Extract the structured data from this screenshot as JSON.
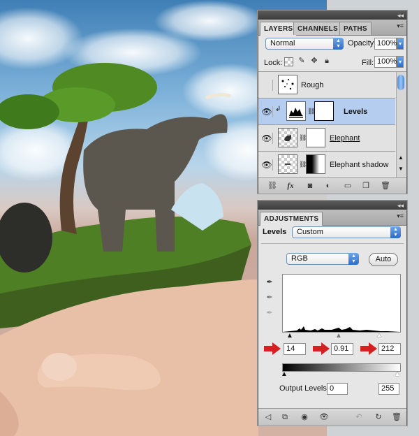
{
  "layers_panel": {
    "tabs": [
      "LAYERS",
      "CHANNELS",
      "PATHS"
    ],
    "blend_mode": "Normal",
    "opacity_label": "Opacity:",
    "opacity_value": "100%",
    "lock_label": "Lock:",
    "fill_label": "Fill:",
    "fill_value": "100%",
    "layers": [
      {
        "name": "Rough",
        "visible": false
      },
      {
        "name": "Levels",
        "visible": true,
        "selected": true
      },
      {
        "name": "Elephant",
        "visible": true
      },
      {
        "name": "Elephant shadow",
        "visible": true
      }
    ],
    "bottom_icons": [
      "link-icon",
      "fx-icon",
      "mask-icon",
      "adjustment-icon",
      "group-icon",
      "new-layer-icon",
      "trash-icon"
    ]
  },
  "adjustments_panel": {
    "tab": "ADJUSTMENTS",
    "preset_label": "Levels",
    "preset_value": "Custom",
    "channel": "RGB",
    "auto_label": "Auto",
    "input_black": "14",
    "input_gray": "0.91",
    "input_white": "212",
    "output_label": "Output Levels:",
    "output_black": "0",
    "output_white": "255"
  },
  "histogram": {
    "channel": "RGB",
    "black_point": 14,
    "gamma": 0.91,
    "white_point": 212
  },
  "colors": {
    "selection": "#b5cdee",
    "accent": "#2d6cc9",
    "arrow": "#d42020"
  }
}
